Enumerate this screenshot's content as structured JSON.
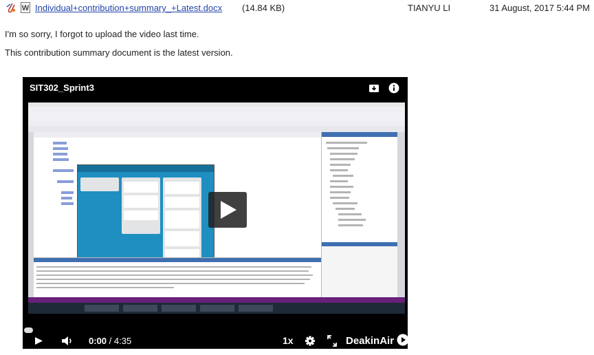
{
  "attachment": {
    "clip_icon": "paperclip-icon",
    "file_icon": "word-document-icon",
    "file_icon_letter": "W",
    "file_name": "Individual+contribution+summary_+Latest.docx",
    "file_size": "(14.84 KB)",
    "author": "TIANYU LI",
    "date": "31 August, 2017 5:44 PM"
  },
  "messages": [
    "I'm so sorry, I forgot to upload the video last time.",
    "This contribution summary document is the latest version."
  ],
  "player": {
    "title": "SIT302_Sprint3",
    "download_icon": "download-icon",
    "info_icon": "info-icon",
    "play_overlay_icon": "play-icon",
    "progress_fraction": 0,
    "controls": {
      "play_icon": "play-icon",
      "volume_icon": "volume-icon",
      "current_time": "0:00",
      "separator": " / ",
      "duration": "4:35",
      "speed": "1x",
      "settings_icon": "gear-icon",
      "fullscreen_icon": "fullscreen-icon",
      "brand": "DeakinAir",
      "brand_play_icon": "play-circle-icon"
    }
  },
  "colors": {
    "link": "#2244aa",
    "player_bg": "#000000",
    "vs_purple": "#68217a",
    "trello_blue": "#1e8fc0"
  }
}
